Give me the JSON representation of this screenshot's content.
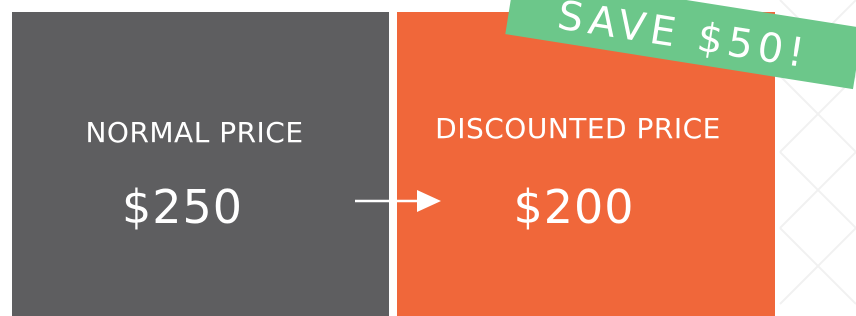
{
  "normal": {
    "title": "NORMAL PRICE",
    "price": "$250"
  },
  "discounted": {
    "title": "DISCOUNTED PRICE",
    "price": "$200"
  },
  "banner": {
    "text": "SAVE $50!"
  },
  "colors": {
    "normal_panel": "#5e5e60",
    "discount_panel": "#f0673a",
    "banner": "#6cc78a",
    "text": "#ffffff"
  },
  "icons": {
    "arrow": "right-arrow-icon"
  }
}
